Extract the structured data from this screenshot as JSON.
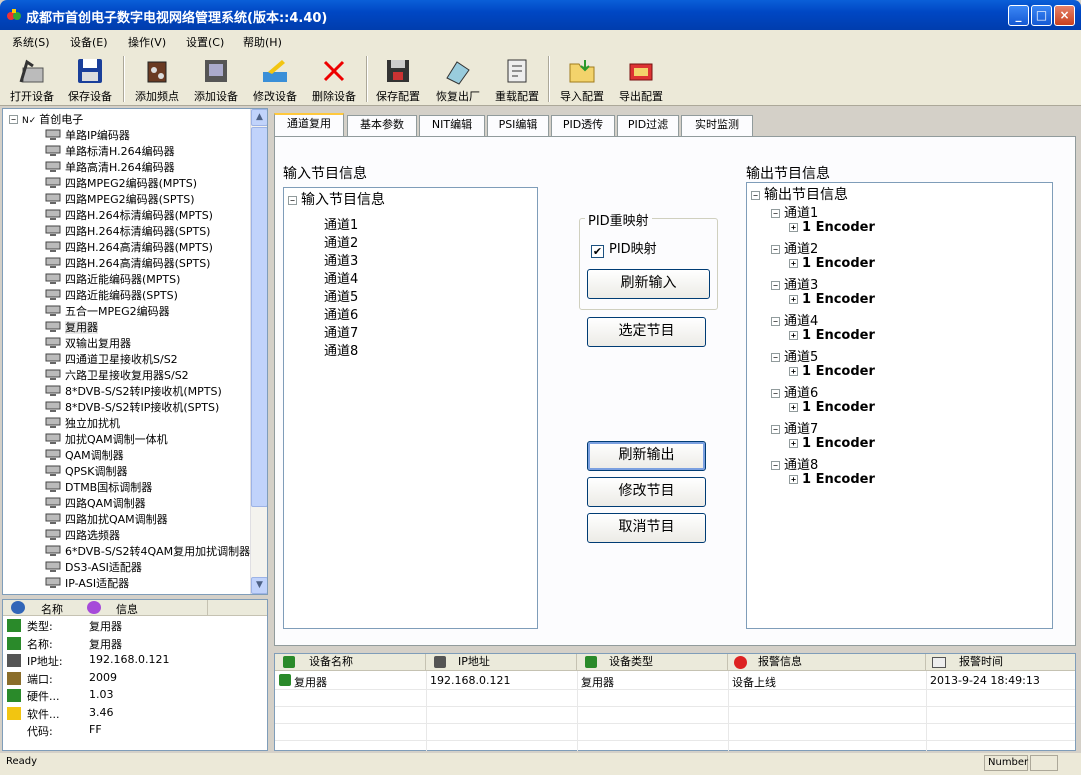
{
  "window": {
    "title": "成都市首创电子数字电视网络管理系统(版本::4.40)",
    "minimize": "_",
    "maximize": "□",
    "close": "×"
  },
  "menu": [
    "系统(S)",
    "设备(E)",
    "操作(V)",
    "设置(C)",
    "帮助(H)"
  ],
  "toolbar": [
    "打开设备",
    "保存设备",
    "添加频点",
    "添加设备",
    "修改设备",
    "删除设备",
    "保存配置",
    "恢复出厂",
    "重载配置",
    "导入配置",
    "导出配置"
  ],
  "tree": {
    "root": "首创电子",
    "items": [
      "单路IP编码器",
      "单路标清H.264编码器",
      "单路高清H.264编码器",
      "四路MPEG2编码器(MPTS)",
      "四路MPEG2编码器(SPTS)",
      "四路H.264标清编码器(MPTS)",
      "四路H.264标清编码器(SPTS)",
      "四路H.264高清编码器(MPTS)",
      "四路H.264高清编码器(SPTS)",
      "四路近能编码器(MPTS)",
      "四路近能编码器(SPTS)",
      "五合一MPEG2编码器",
      "复用器",
      "双输出复用器",
      "四通道卫星接收机S/S2",
      "六路卫星接收复用器S/S2",
      "8*DVB-S/S2转IP接收机(MPTS)",
      "8*DVB-S/S2转IP接收机(SPTS)",
      "独立加扰机",
      "加扰QAM调制一体机",
      "QAM调制器",
      "QPSK调制器",
      "DTMB国标调制器",
      "四路QAM调制器",
      "四路加扰QAM调制器",
      "四路选频器",
      "6*DVB-S/S2转4QAM复用加扰调制器",
      "DS3-ASI适配器",
      "IP-ASI适配器"
    ],
    "selected_index": 12
  },
  "info": {
    "headers": [
      "名称",
      "信息"
    ],
    "rows": [
      {
        "k": "类型:",
        "v": "复用器"
      },
      {
        "k": "名称:",
        "v": "复用器"
      },
      {
        "k": "IP地址:",
        "v": "192.168.0.121"
      },
      {
        "k": "端口:",
        "v": "2009"
      },
      {
        "k": "硬件...",
        "v": "1.03"
      },
      {
        "k": "软件...",
        "v": "3.46"
      },
      {
        "k": "代码:",
        "v": "FF"
      }
    ]
  },
  "tabs": [
    "通道复用",
    "基本参数",
    "NIT编辑",
    "PSI编辑",
    "PID透传",
    "PID过滤",
    "实时监测"
  ],
  "active_tab": 0,
  "input": {
    "label": "输入节目信息",
    "root": "输入节目信息",
    "channels": [
      "通道1",
      "通道2",
      "通道3",
      "通道4",
      "通道5",
      "通道6",
      "通道7",
      "通道8"
    ]
  },
  "output": {
    "label": "输出节目信息",
    "root": "输出节目信息",
    "channels": [
      "通道1",
      "通道2",
      "通道3",
      "通道4",
      "通道5",
      "通道6",
      "通道7",
      "通道8"
    ],
    "child": "1 Encoder"
  },
  "pid_group": {
    "title": "PID重映射",
    "checkbox": "PID映射",
    "checked": true
  },
  "buttons": {
    "refresh_input": "刷新输入",
    "select": "选定节目",
    "refresh_output": "刷新输出",
    "modify": "修改节目",
    "cancel": "取消节目"
  },
  "alarm": {
    "headers": [
      "设备名称",
      "IP地址",
      "设备类型",
      "报警信息",
      "报警时间"
    ],
    "rows": [
      {
        "name": "复用器",
        "ip": "192.168.0.121",
        "type": "复用器",
        "msg": "设备上线",
        "time": "2013-9-24 18:49:13"
      }
    ]
  },
  "status": {
    "text": "Ready",
    "panel": "Number"
  }
}
